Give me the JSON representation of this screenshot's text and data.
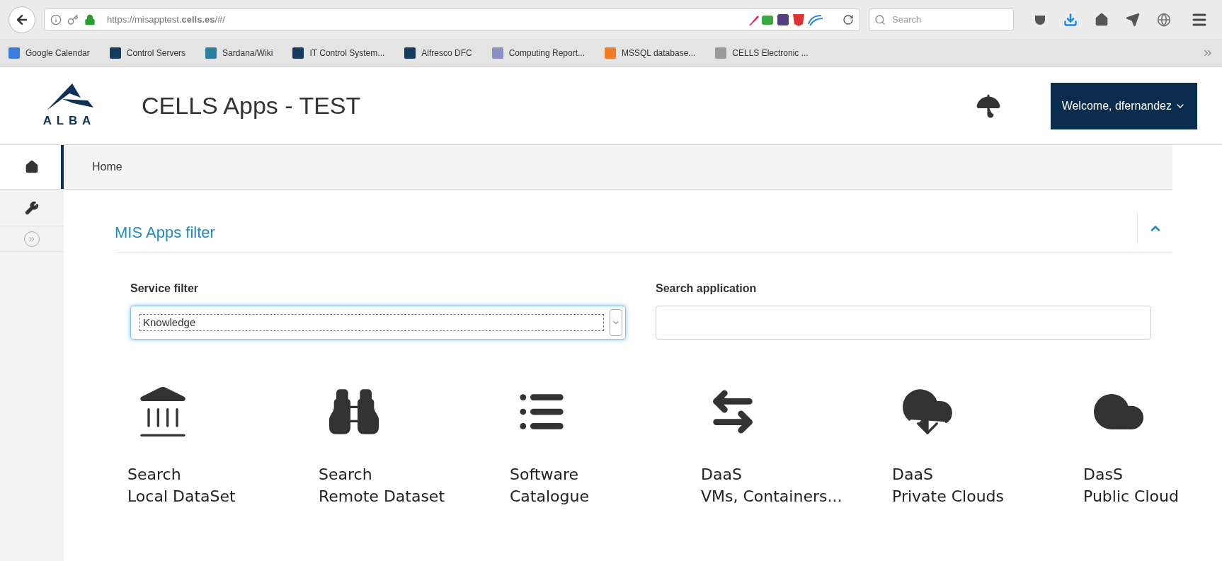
{
  "browser": {
    "url": "https://misapptest.**cells.es**/#/",
    "search_placeholder": "Search",
    "bookmarks": [
      {
        "label": "Google Calendar",
        "color": "#3b7ddd"
      },
      {
        "label": "Control Servers",
        "color": "#163a5c"
      },
      {
        "label": "Sardana/Wiki",
        "color": "#2a7f9e"
      },
      {
        "label": "IT Control System...",
        "color": "#163a5c"
      },
      {
        "label": "Alfresco DFC",
        "color": "#163a5c"
      },
      {
        "label": "Computing Report...",
        "color": "#8a8fc0"
      },
      {
        "label": "MSSQL database...",
        "color": "#f07b27"
      },
      {
        "label": "CELLS Electronic ...",
        "color": "#9a9a9a"
      }
    ]
  },
  "header": {
    "logo_text": "ALBA",
    "title": "CELLS Apps - TEST",
    "user_button": "Welcome, dfernandez"
  },
  "sidebar": {
    "items": [
      {
        "kind": "home",
        "selected": true
      },
      {
        "kind": "tools",
        "selected": false
      },
      {
        "kind": "expand",
        "selected": false
      }
    ]
  },
  "breadcrumb": "Home",
  "panel": {
    "title": "MIS Apps filter",
    "expanded": true,
    "fields": [
      {
        "kind": "select",
        "label": "Service filter",
        "value": "Knowledge"
      },
      {
        "kind": "text",
        "label": "Search application"
      }
    ]
  },
  "apps": [
    {
      "kind": "bank",
      "line1": "Search",
      "line2": "Local DataSet"
    },
    {
      "kind": "binoculars",
      "line1": "Search",
      "line2": "Remote Dataset"
    },
    {
      "kind": "list",
      "line1": "Software",
      "line2": "Catalogue"
    },
    {
      "kind": "exchange",
      "line1": "DaaS",
      "line2": "VMs, Containers..."
    },
    {
      "kind": "cloud-download",
      "line1": "DaaS",
      "line2": "Private Clouds"
    },
    {
      "kind": "cloud",
      "line1": "DasS",
      "line2": "Public Cloud"
    }
  ]
}
